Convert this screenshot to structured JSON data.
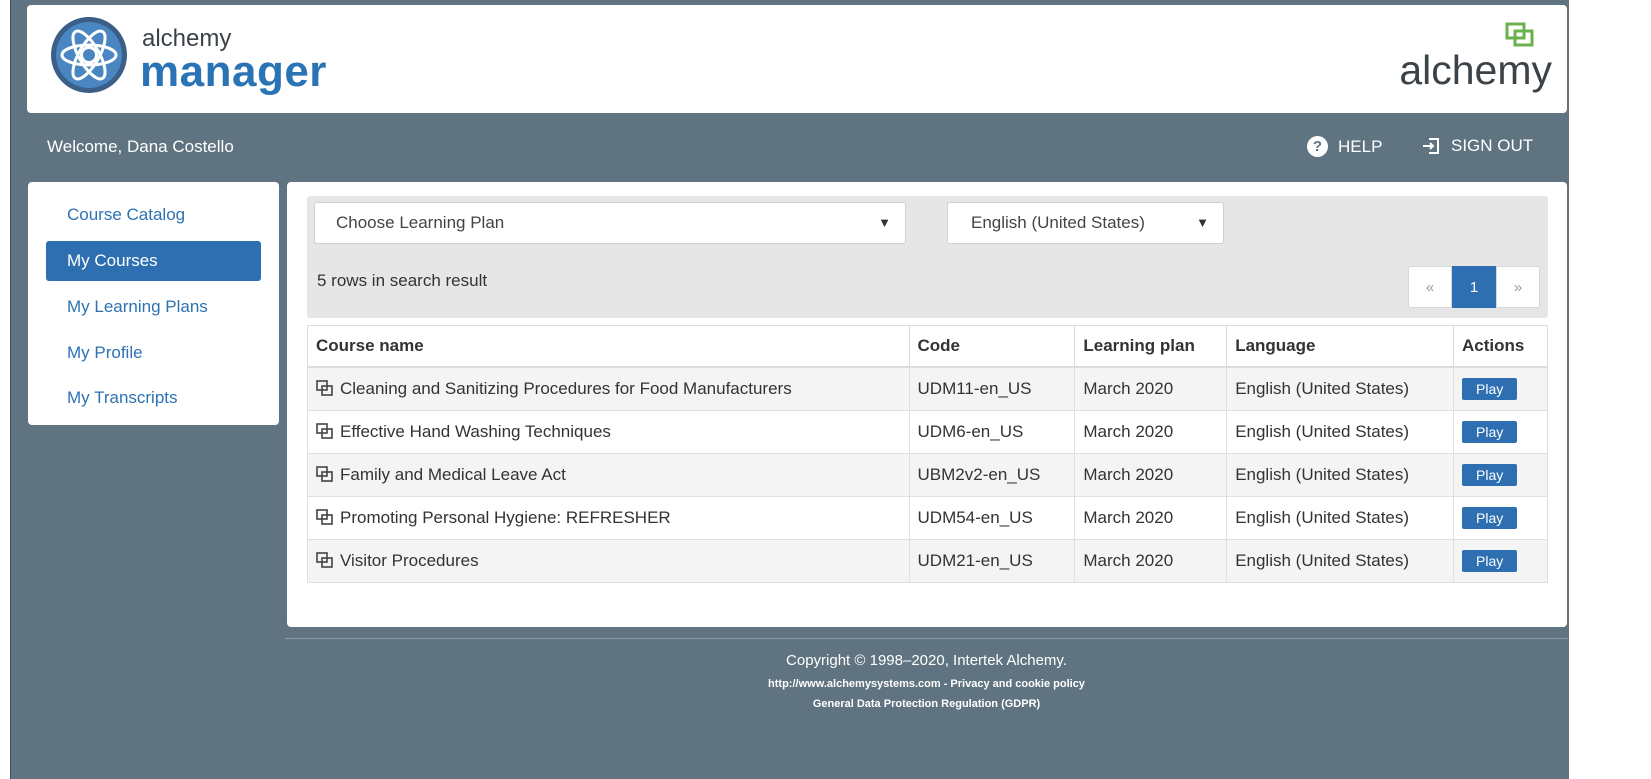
{
  "header": {
    "logo_small": "alchemy",
    "logo_big": "manager",
    "brand_word": "alchemy"
  },
  "topbar": {
    "welcome": "Welcome, Dana Costello",
    "help_label": "HELP",
    "signout_label": "SIGN OUT"
  },
  "sidebar": {
    "items": [
      {
        "label": "Course Catalog"
      },
      {
        "label": "My Courses"
      },
      {
        "label": "My Learning Plans"
      },
      {
        "label": "My Profile"
      },
      {
        "label": "My Transcripts"
      }
    ]
  },
  "filters": {
    "learning_plan": "Choose Learning Plan",
    "language": "English (United States)"
  },
  "results": {
    "count_text": "5 rows in search result"
  },
  "pager": {
    "prev": "«",
    "current": "1",
    "next": "»"
  },
  "table": {
    "headers": [
      "Course name",
      "Code",
      "Learning plan",
      "Language",
      "Actions"
    ],
    "rows": [
      {
        "name": "Cleaning and Sanitizing Procedures for Food Manufacturers",
        "code": "UDM11-en_US",
        "plan": "March 2020",
        "language": "English (United States)",
        "action": "Play"
      },
      {
        "name": "Effective Hand Washing Techniques",
        "code": "UDM6-en_US",
        "plan": "March 2020",
        "language": "English (United States)",
        "action": "Play"
      },
      {
        "name": "Family and Medical Leave Act",
        "code": "UBM2v2-en_US",
        "plan": "March 2020",
        "language": "English (United States)",
        "action": "Play"
      },
      {
        "name": "Promoting Personal Hygiene: REFRESHER",
        "code": "UDM54-en_US",
        "plan": "March 2020",
        "language": "English (United States)",
        "action": "Play"
      },
      {
        "name": "Visitor Procedures",
        "code": "UDM21-en_US",
        "plan": "March 2020",
        "language": "English (United States)",
        "action": "Play"
      }
    ]
  },
  "footer": {
    "copyright": "Copyright © 1998–2020, Intertek Alchemy.",
    "site_link": "http://www.alchemysystems.com",
    "separator": " - ",
    "privacy_link": "Privacy and cookie policy",
    "gdpr_link": "General Data Protection Regulation (GDPR)"
  },
  "colors": {
    "background": "#5f7380",
    "accent": "#2d6fb0",
    "brand_green": "#6ab04c"
  }
}
